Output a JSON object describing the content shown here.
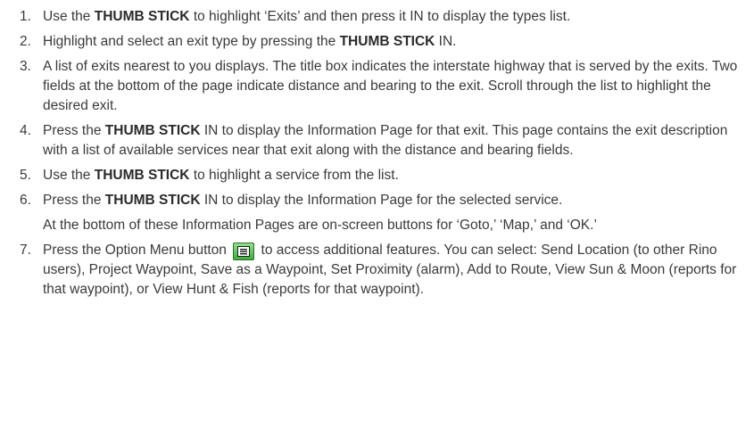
{
  "steps": [
    {
      "num": "1.",
      "parts": [
        "Use the ",
        "THUMB STICK",
        " to highlight ‘Exits’ and then press it IN to display the types list."
      ]
    },
    {
      "num": "2.",
      "parts": [
        "Highlight and select an exit type by pressing the ",
        "THUMB STICK",
        " IN."
      ]
    },
    {
      "num": "3.",
      "text": "A list of exits nearest to you displays. The title box indicates the interstate highway that is served by the exits. Two fields at the bottom of the page indicate distance and bearing to the exit. Scroll through the list to highlight the desired exit."
    },
    {
      "num": "4.",
      "parts": [
        "Press the ",
        "THUMB STICK",
        " IN to display the Information Page for that exit. This page contains the exit description with a list of available services near that exit along with the distance and bearing fields."
      ]
    },
    {
      "num": "5.",
      "parts": [
        "Use the ",
        "THUMB STICK",
        " to highlight a service from the list."
      ]
    },
    {
      "num": "6.",
      "parts": [
        "Press the ",
        "THUMB STICK",
        " IN to display the Information Page for the selected service."
      ],
      "note": "At the bottom of these Information Pages are on-screen buttons for ‘Goto,’ ‘Map,’ and ‘OK.’"
    },
    {
      "num": "7.",
      "parts": [
        "Press the Option Menu button ",
        " to access additional features. You can select: Send Location (to other Rino users), Project Waypoint, Save as a Waypoint, Set Proximity (alarm), Add to Route, View Sun & Moon (reports for that waypoint), or View Hunt & Fish (reports for that waypoint)."
      ]
    }
  ],
  "icons": {
    "option_menu": "option-menu-icon"
  },
  "colors": {
    "text": "#3a3a3a",
    "menu_button": "#4fbf4c"
  }
}
